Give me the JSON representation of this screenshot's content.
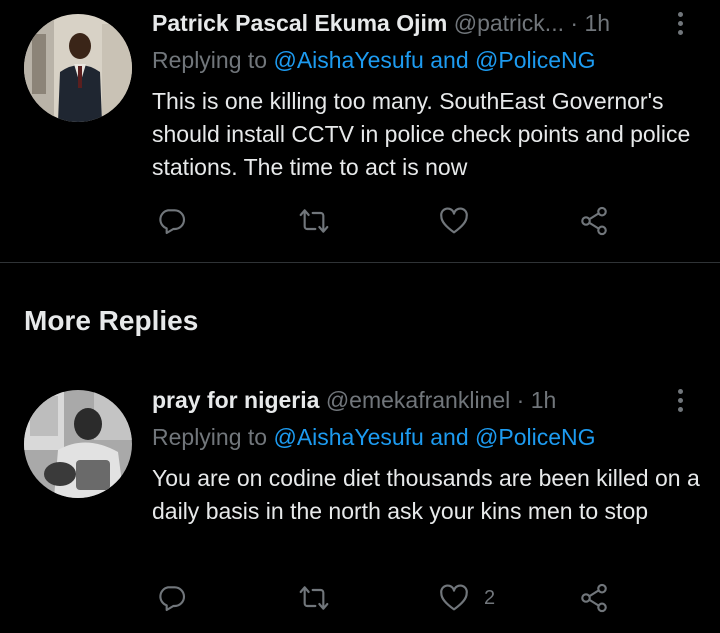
{
  "tweets": [
    {
      "name": "Patrick Pascal Ekuma Ojim",
      "handle": "@patrick...",
      "dot": "·",
      "time": "1h",
      "replying_prefix": "Replying to ",
      "mention1": "@AishaYesufu",
      "and": " and ",
      "mention2": "@PoliceNG",
      "body": "This is one killing too many. SouthEast Governor's should install CCTV in police check points and police stations. The time to act is now",
      "like_count": ""
    },
    {
      "name": "pray for nigeria",
      "handle": "@emekafranklinel",
      "dot": "·",
      "time": "1h",
      "replying_prefix": "Replying to ",
      "mention1": "@AishaYesufu",
      "and": " and ",
      "mention2": "@PoliceNG",
      "body": "You are on codine diet thousands are been killed on a daily basis in the north ask your kins men to stop",
      "like_count": "2"
    }
  ],
  "section": {
    "title": "More Replies"
  },
  "icons": {
    "reply": "reply-icon",
    "retweet": "retweet-icon",
    "like": "heart-icon",
    "share": "share-icon",
    "more": "more-vertical-icon"
  },
  "colors": {
    "background": "#000000",
    "text": "#e7e9ea",
    "muted": "#71767b",
    "accent": "#1d9bf0"
  }
}
